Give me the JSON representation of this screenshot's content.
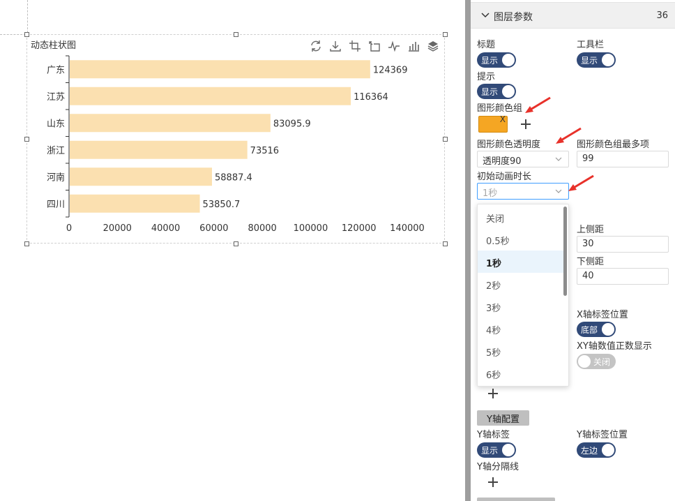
{
  "chart": {
    "title": "动态柱状图"
  },
  "chart_data": {
    "type": "bar",
    "orientation": "horizontal",
    "categories": [
      "广东",
      "江苏",
      "山东",
      "浙江",
      "河南",
      "四川"
    ],
    "values": [
      124369,
      116364,
      83095.9,
      73516,
      58887.4,
      53850.7
    ],
    "value_labels": [
      "124369",
      "116364",
      "83095.9",
      "73516",
      "58887.4",
      "53850.7"
    ],
    "x_ticks": [
      "0",
      "20000",
      "40000",
      "60000",
      "80000",
      "100000",
      "120000",
      "140000"
    ],
    "xlim": [
      0,
      140000
    ],
    "bar_color": "#fbe0b0",
    "grid": false,
    "legend": "none"
  },
  "panel": {
    "title": "图层参数",
    "count": "36",
    "title_label": "标题",
    "title_toggle": "显示",
    "toolbar_label": "工具栏",
    "toolbar_toggle": "显示",
    "tooltip_label": "提示",
    "tooltip_toggle": "显示",
    "color_group_label": "图形颜色组",
    "swatch_color": "#f5a623",
    "swatch_close": "X",
    "opacity_label": "图形颜色透明度",
    "opacity_value": "透明度90",
    "max_colors_label": "图形颜色组最多项",
    "max_colors_value": "99",
    "anim_label": "初始动画时长",
    "anim_value": "1秒",
    "top_margin_label": "上侧距",
    "top_margin_value": "30",
    "bottom_margin_label": "下侧距",
    "bottom_margin_value": "40",
    "x_label_pos_label": "X轴标签位置",
    "x_label_pos_toggle": "底部",
    "xy_integer_label": "XY轴数值正数显示",
    "xy_integer_toggle": "关闭",
    "y_axis_button": "Y轴配置",
    "y_label_label": "Y轴标签",
    "y_label_toggle": "显示",
    "y_label_pos_label": "Y轴标签位置",
    "y_label_pos_toggle": "左边",
    "y_split_label": "Y轴分隔线"
  },
  "dropdown": {
    "options": [
      "关闭",
      "0.5秒",
      "1秒",
      "2秒",
      "3秒",
      "4秒",
      "5秒",
      "6秒"
    ],
    "selected_index": 2
  },
  "colors": {
    "toggle_on": "#314a78",
    "toggle_off": "#c4c4c4",
    "annotation_arrow": "#e8312a"
  }
}
